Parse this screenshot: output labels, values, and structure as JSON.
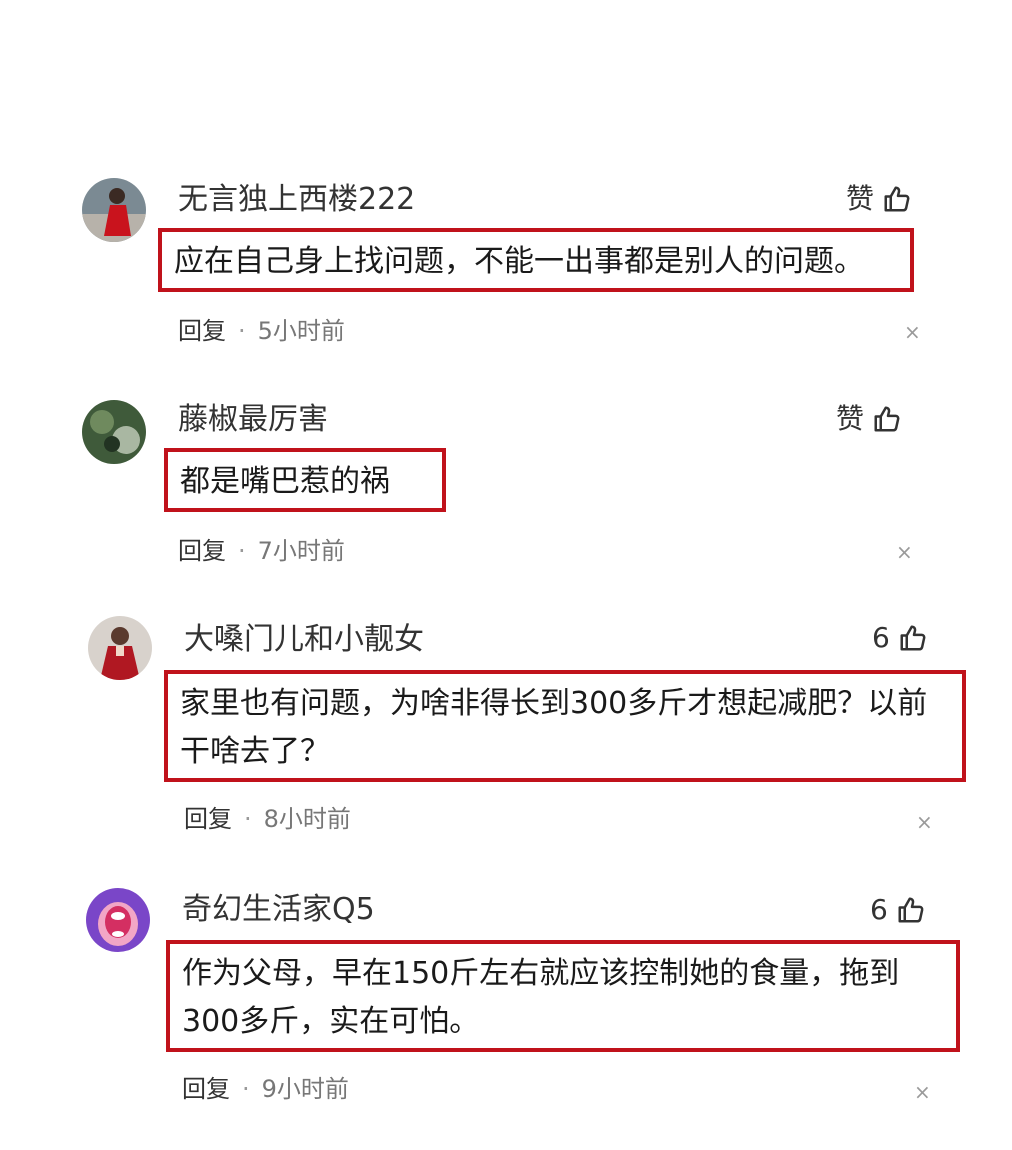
{
  "comments": [
    {
      "username": "无言独上西楼222",
      "like": "赞",
      "text": "应在自己身上找问题，不能一出事都是别人的问题。",
      "reply": "回复",
      "separator": "·",
      "time": "5小时前",
      "close": "×",
      "avatar_icon": "user-avatar-red-dress"
    },
    {
      "username": "藤椒最厉害",
      "like": "赞",
      "text": "都是嘴巴惹的祸",
      "reply": "回复",
      "separator": "·",
      "time": "7小时前",
      "close": "×",
      "avatar_icon": "user-avatar-green"
    },
    {
      "username": "大嗓门儿和小靓女",
      "like": "6",
      "text": "家里也有问题，为啥非得长到300多斤才想起减肥？以前干啥去了？",
      "reply": "回复",
      "separator": "·",
      "time": "8小时前",
      "close": "×",
      "avatar_icon": "user-avatar-red-figure"
    },
    {
      "username": "奇幻生活家Q5",
      "like": "6",
      "text": "作为父母，早在150斤左右就应该控制她的食量，拖到300多斤，实在可怕。",
      "reply": "回复",
      "separator": "·",
      "time": "9小时前",
      "close": "×",
      "avatar_icon": "user-avatar-purple-cartoon"
    }
  ],
  "colors": {
    "highlight_border": "#c0121b",
    "text": "#1a1a1a",
    "meta": "#777777"
  }
}
